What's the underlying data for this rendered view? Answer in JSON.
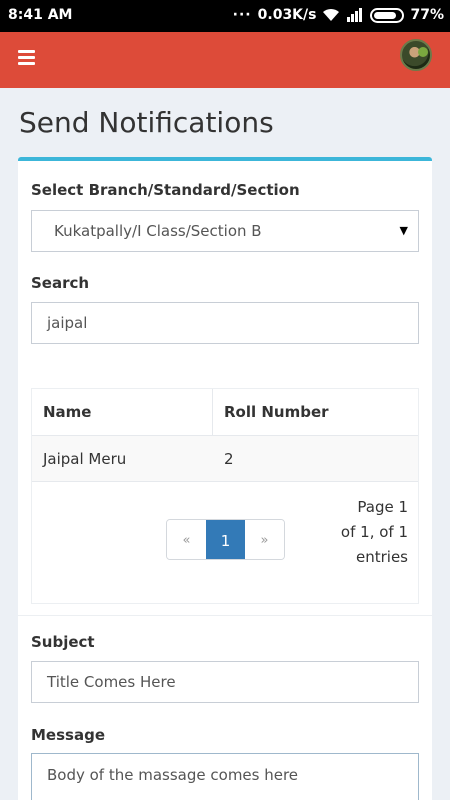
{
  "status_bar": {
    "time": "8:41 AM",
    "network_speed": "0.03K/s",
    "battery": "77%",
    "icons": [
      "wifi-icon",
      "signal-icon",
      "battery-icon"
    ]
  },
  "header": {
    "menu_icon": "hamburger-menu-icon",
    "accent_color": "#dd4b39"
  },
  "page": {
    "title": "Send Notifications"
  },
  "form": {
    "branch_label": "Select Branch/Standard/Section",
    "branch_value": "Kukatpally/I Class/Section B",
    "search_label": "Search",
    "search_value": "jaipal",
    "subject_label": "Subject",
    "subject_placeholder": "Title Comes Here",
    "message_label": "Message",
    "message_placeholder": "Body of the massage comes here"
  },
  "table": {
    "columns": [
      "Name",
      "Roll Number"
    ],
    "rows": [
      [
        "Jaipal Meru",
        "2"
      ]
    ],
    "pagination": {
      "prev": "«",
      "current": "1",
      "next": "»",
      "info_line1": "Page 1",
      "info_line2": "of 1, of 1",
      "info_line3": "entries"
    }
  },
  "colors": {
    "box_top_border": "#3cb6d9",
    "active_page": "#337ab7"
  }
}
